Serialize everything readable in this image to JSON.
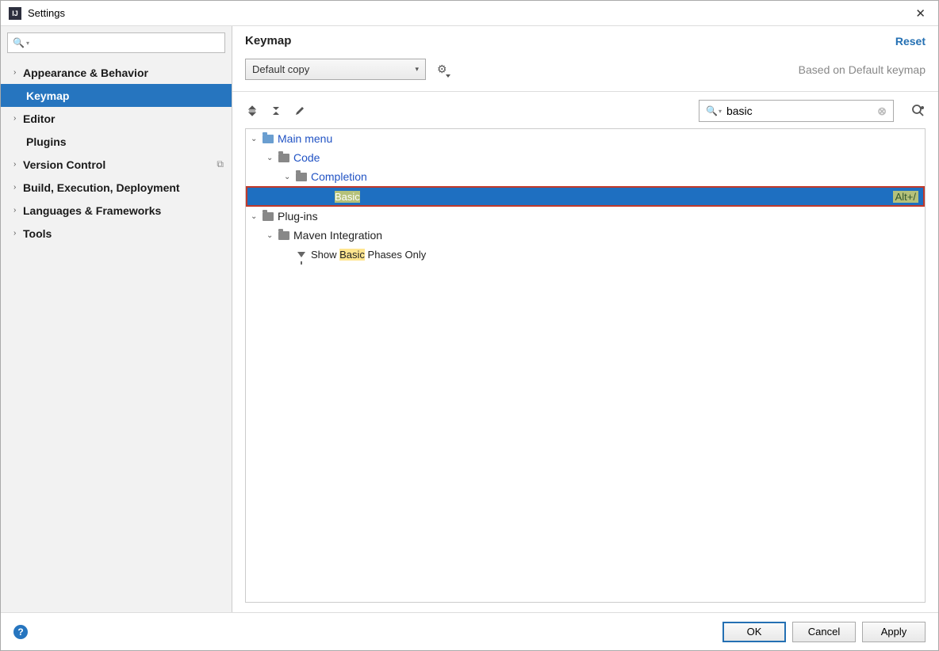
{
  "window": {
    "title": "Settings"
  },
  "sidebar": {
    "search_placeholder": "",
    "items": [
      {
        "label": "Appearance & Behavior",
        "expandable": true
      },
      {
        "label": "Keymap",
        "expandable": false,
        "selected": true
      },
      {
        "label": "Editor",
        "expandable": true
      },
      {
        "label": "Plugins",
        "expandable": false
      },
      {
        "label": "Version Control",
        "expandable": true,
        "project": true
      },
      {
        "label": "Build, Execution, Deployment",
        "expandable": true
      },
      {
        "label": "Languages & Frameworks",
        "expandable": true
      },
      {
        "label": "Tools",
        "expandable": true
      }
    ]
  },
  "panel": {
    "title": "Keymap",
    "reset": "Reset",
    "selected_keymap": "Default copy",
    "based_on": "Based on Default keymap",
    "search_value": "basic"
  },
  "tree": {
    "r0": {
      "label": "Main menu"
    },
    "r1": {
      "label": "Code"
    },
    "r2": {
      "label": "Completion"
    },
    "r3": {
      "label": "Basic",
      "shortcut": "Alt+/"
    },
    "r4": {
      "label": "Plug-ins"
    },
    "r5": {
      "label": "Maven Integration"
    },
    "r6": {
      "pre": "Show ",
      "hl": "Basic",
      "post": " Phases Only"
    }
  },
  "buttons": {
    "ok": "OK",
    "cancel": "Cancel",
    "apply": "Apply"
  }
}
